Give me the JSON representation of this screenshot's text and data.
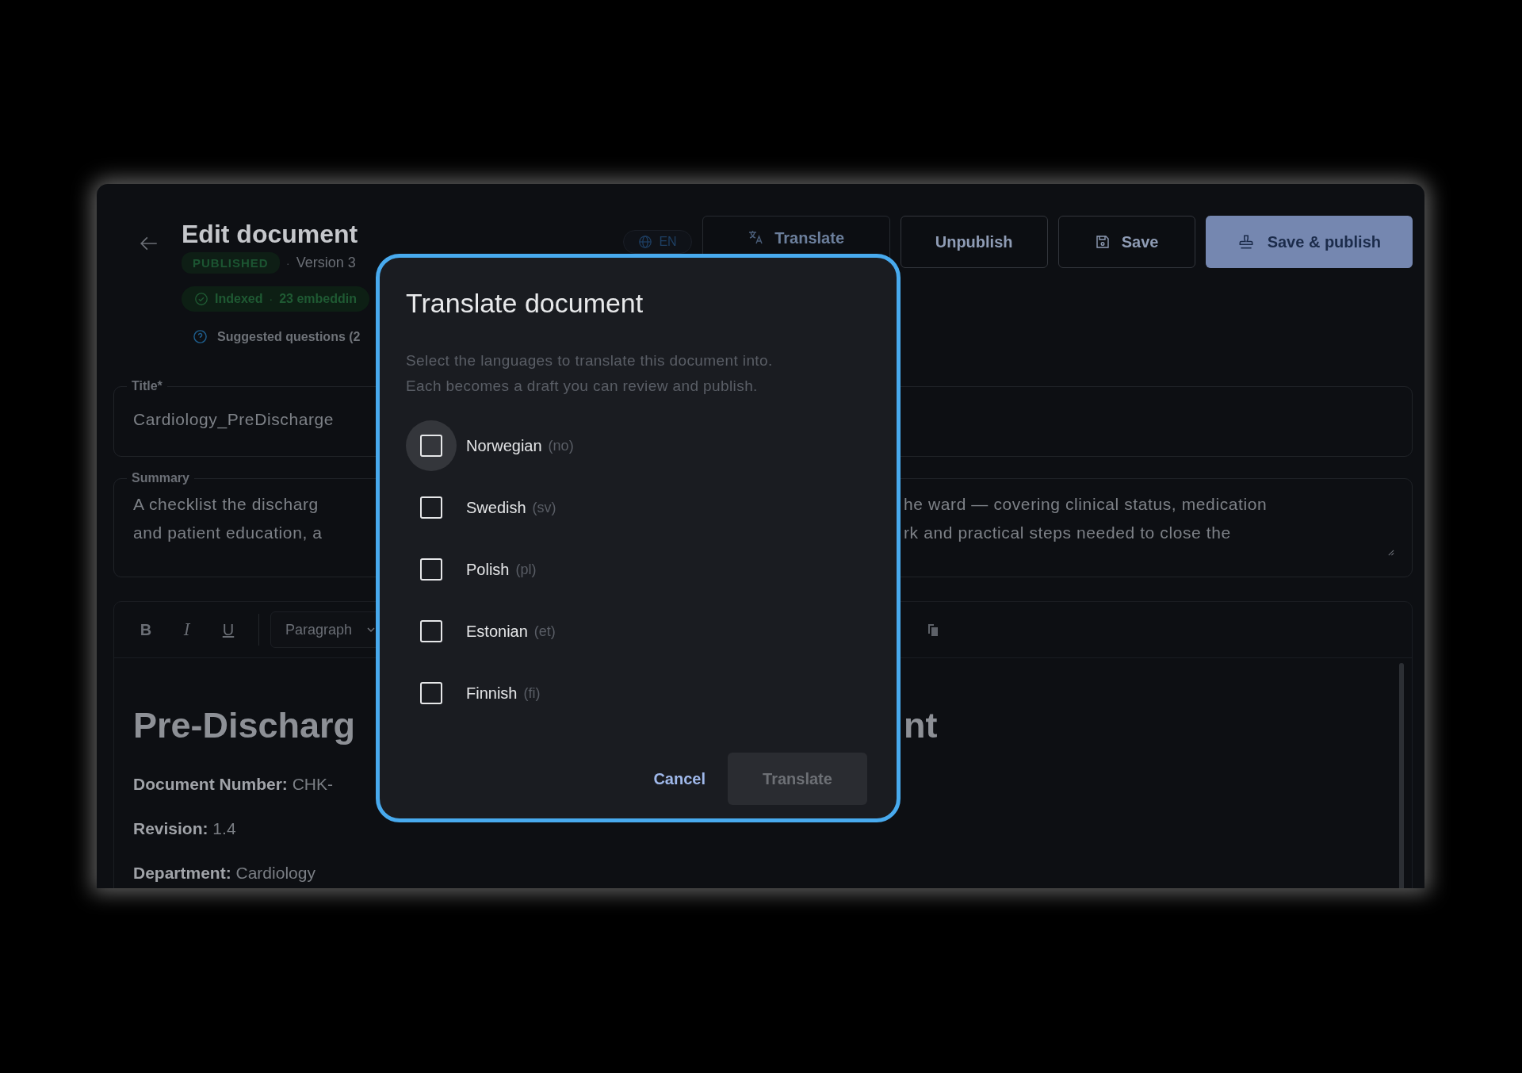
{
  "header": {
    "title": "Edit document",
    "status_row": {
      "status": "PUBLISHED",
      "separator": "·",
      "version": "Version 3"
    },
    "index_badge": {
      "label": "Indexed",
      "separator": "·",
      "detail": "23 embeddin"
    },
    "suggested": "Suggested questions (2"
  },
  "actions": [
    {
      "kind": "language",
      "label": "EN"
    },
    {
      "kind": "translate",
      "label": "Translate"
    },
    {
      "kind": "outline",
      "label": "Unpublish"
    },
    {
      "kind": "save",
      "label": "Save"
    },
    {
      "kind": "primary",
      "label": "Save & publish"
    }
  ],
  "title_field": {
    "label": "Title*",
    "value": "Cardiology_PreDischarge"
  },
  "summary_field": {
    "label": "Summary",
    "left": [
      "A checklist the discharg",
      "and patient education, a"
    ],
    "right": [
      "he ward — covering clinical status, medication",
      "rk and practical steps needed to close the"
    ]
  },
  "toolbar": {
    "formats": [
      {
        "kind": "bold",
        "label": "B"
      },
      {
        "kind": "italic",
        "label": "I"
      },
      {
        "kind": "underline",
        "label": "U"
      }
    ],
    "block_style": "Paragraph"
  },
  "editor": {
    "heading_left": "Pre-Discharg",
    "heading_right": "nt",
    "lines": [
      {
        "label": "Document Number:",
        "value": "CHK-"
      },
      {
        "label": "Revision:",
        "value": "1.4"
      },
      {
        "label": "Department:",
        "value": "Cardiology"
      }
    ]
  },
  "dialog": {
    "title": "Translate document",
    "description": [
      "Select the languages to translate this document into.",
      "Each becomes a draft you can review and publish."
    ],
    "languages": [
      {
        "name": "Norwegian",
        "code": "(no)",
        "checked": false,
        "focused": true
      },
      {
        "name": "Swedish",
        "code": "(sv)",
        "checked": false,
        "focused": false
      },
      {
        "name": "Polish",
        "code": "(pl)",
        "checked": false,
        "focused": false
      },
      {
        "name": "Estonian",
        "code": "(et)",
        "checked": false,
        "focused": false
      },
      {
        "name": "Finnish",
        "code": "(fi)",
        "checked": false,
        "focused": false
      }
    ],
    "cancel": "Cancel",
    "confirm": {
      "label": "Translate",
      "disabled": true
    }
  }
}
